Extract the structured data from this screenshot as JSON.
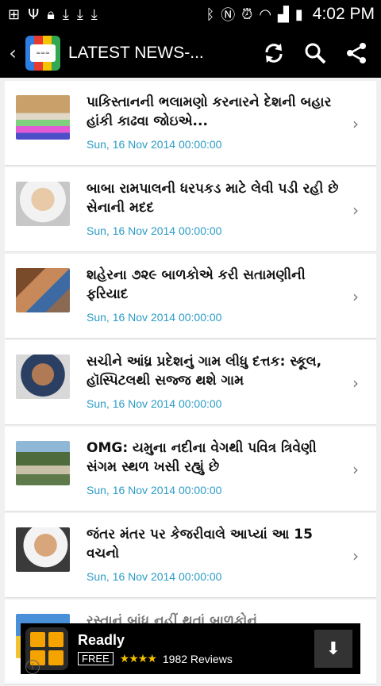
{
  "statusbar": {
    "time": "4:02 PM"
  },
  "appbar": {
    "title": "LATEST NEWS-..."
  },
  "items": [
    {
      "title": "પાકિસ્તાનની ભલામણો કરનારને દેશની બહાર હાંકી કાઢવા જોઇએ...",
      "date": "Sun, 16 Nov 2014 00:00:00"
    },
    {
      "title": "બાબા રામપાલની ધરપકડ માટે લેવી પડી રહી છે સેનાની મદદ",
      "date": "Sun, 16 Nov 2014 00:00:00"
    },
    {
      "title": "શહેરના ૭૨૯ બાળકોએ કરી સતામણીની ફરિયાદ",
      "date": "Sun, 16 Nov 2014 00:00:00"
    },
    {
      "title": "સચીને આંધ્ર પ્રદેશનું ગામ લીધુ દત્તક: સ્કૂલ, હૉસ્પિટલથી સજ્જ થશે ગામ",
      "date": "Sun, 16 Nov 2014 00:00:00"
    },
    {
      "title": "OMG: યમુના નદીના વેગથી પવિત્ર ત્રિવેણી સંગમ સ્થળ ખસી રહ્યું છે",
      "date": "Sun, 16 Nov 2014 00:00:00"
    },
    {
      "title": "જંતર મંતર પર કેજરીવાલે આપ્યાં આ 15 વચનો",
      "date": "Sun, 16 Nov 2014 00:00:00"
    },
    {
      "title": "રસ્તાનું બાંધ નહીં થતાં બાળકોનું",
      "date": ""
    }
  ],
  "ad": {
    "name": "Readly",
    "free": "FREE",
    "stars": "★★★★",
    "reviews": "1982 Reviews"
  },
  "colors": {
    "date": "#2b9cc6",
    "appbar": "#000000",
    "star": "#f6c000"
  }
}
